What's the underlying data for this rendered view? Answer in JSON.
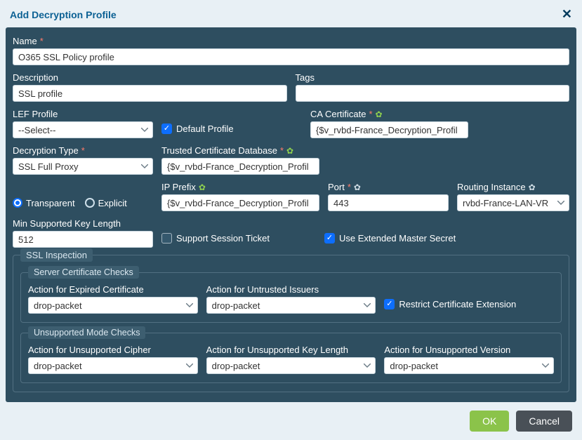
{
  "modal": {
    "title": "Add Decryption Profile"
  },
  "labels": {
    "name": "Name",
    "description": "Description",
    "tags": "Tags",
    "lef_profile": "LEF Profile",
    "default_profile": "Default Profile",
    "ca_cert": "CA Certificate",
    "decryption_type": "Decryption Type",
    "trusted_cert_db": "Trusted Certificate Database",
    "ip_prefix": "IP Prefix",
    "port": "Port",
    "routing_instance": "Routing Instance",
    "min_key_length": "Min Supported Key Length",
    "support_session_ticket": "Support Session Ticket",
    "extended_master_secret": "Use Extended Master Secret",
    "transparent": "Transparent",
    "explicit": "Explicit",
    "ssl_inspection": "SSL Inspection",
    "server_cert_checks": "Server Certificate Checks",
    "action_expired_cert": "Action for Expired Certificate",
    "action_untrusted_issuers": "Action for Untrusted Issuers",
    "restrict_cert_ext": "Restrict Certificate Extension",
    "unsupported_mode_checks": "Unsupported Mode Checks",
    "action_unsupported_cipher": "Action for Unsupported Cipher",
    "action_unsupported_key_length": "Action for Unsupported Key Length",
    "action_unsupported_version": "Action for Unsupported Version"
  },
  "values": {
    "name": "O365 SSL Policy profile",
    "description": "SSL profile",
    "tags": "",
    "lef_profile": "--Select--",
    "default_profile_checked": true,
    "ca_cert": "{$v_rvbd-France_Decryption_Profil",
    "decryption_type": "SSL Full Proxy",
    "trusted_cert_db": "{$v_rvbd-France_Decryption_Profil",
    "mode": "Transparent",
    "ip_prefix": "{$v_rvbd-France_Decryption_Profil",
    "port": "443",
    "routing_instance": "rvbd-France-LAN-VR",
    "min_key_length": "512",
    "support_session_ticket_checked": false,
    "extended_master_secret_checked": true,
    "action_expired_cert": "drop-packet",
    "action_untrusted_issuers": "drop-packet",
    "restrict_cert_ext_checked": true,
    "action_unsupported_cipher": "drop-packet",
    "action_unsupported_key_length": "drop-packet",
    "action_unsupported_version": "drop-packet"
  },
  "buttons": {
    "ok": "OK",
    "cancel": "Cancel"
  }
}
